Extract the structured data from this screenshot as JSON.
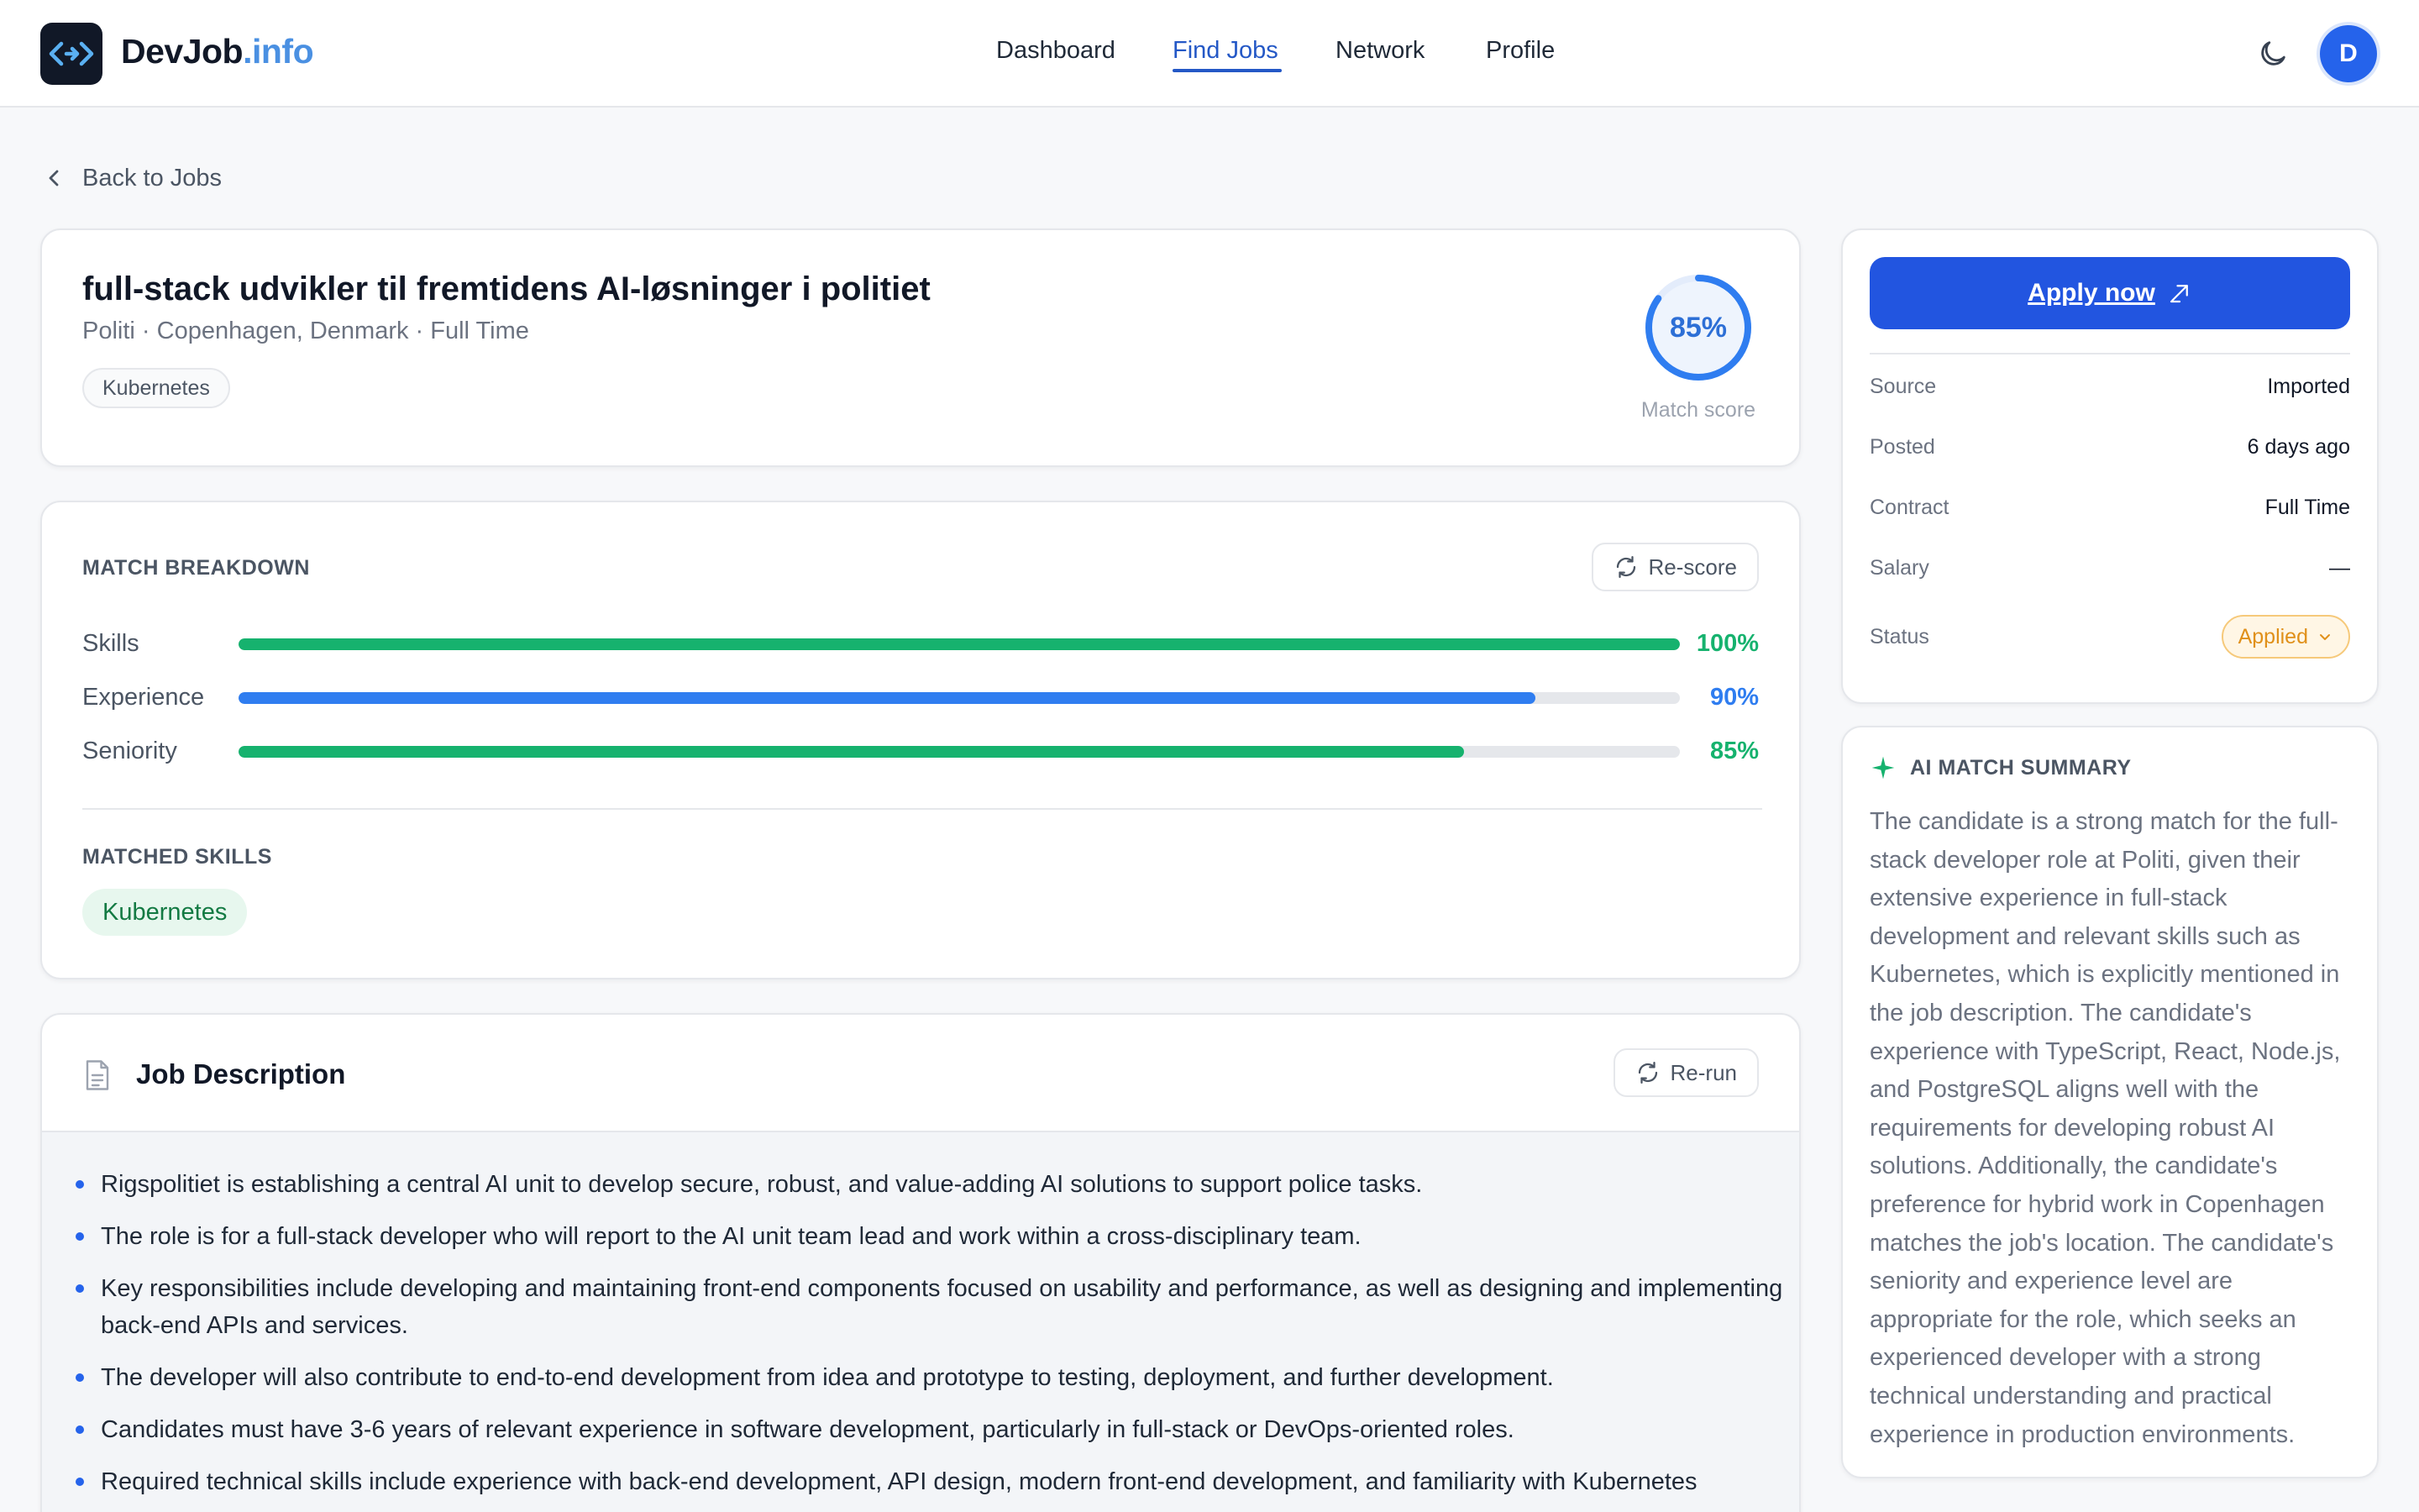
{
  "header": {
    "logo_main": "DevJob",
    "logo_accent": ".info",
    "nav": [
      {
        "label": "Dashboard"
      },
      {
        "label": "Find Jobs"
      },
      {
        "label": "Network"
      },
      {
        "label": "Profile"
      }
    ],
    "avatar_initial": "D"
  },
  "back_link": "Back to Jobs",
  "job": {
    "title": "full-stack udvikler til fremtidens AI-løsninger i politiet",
    "subtitle": "Politi · Copenhagen, Denmark · Full Time",
    "tag": "Kubernetes",
    "match_score": 85,
    "match_score_text": "85%",
    "match_score_label": "Match score"
  },
  "breakdown": {
    "title": "MATCH BREAKDOWN",
    "rescore_label": "Re-score",
    "bars": [
      {
        "label": "Skills",
        "value": 100,
        "pct": "100%",
        "color": "#16b26e"
      },
      {
        "label": "Experience",
        "value": 90,
        "pct": "90%",
        "color": "#2f7df0"
      },
      {
        "label": "Seniority",
        "value": 85,
        "pct": "85%",
        "color": "#16b26e"
      }
    ],
    "matched_title": "MATCHED SKILLS",
    "matched_skills": [
      "Kubernetes"
    ]
  },
  "description": {
    "title": "Job Description",
    "rerun_label": "Re-run",
    "items": [
      "Rigspolitiet is establishing a central AI unit to develop secure, robust, and value-adding AI solutions to support police tasks.",
      "The role is for a full-stack developer who will report to the AI unit team lead and work within a cross-disciplinary team.",
      "Key responsibilities include developing and maintaining front-end components focused on usability and performance, as well as designing and implementing back-end APIs and services.",
      "The developer will also contribute to end-to-end development from idea and prototype to testing, deployment, and further development.",
      "Candidates must have 3-6 years of relevant experience in software development, particularly in full-stack or DevOps-oriented roles.",
      "Required technical skills include experience with back-end development, API design, modern front-end development, and familiarity with Kubernetes"
    ]
  },
  "sidebar": {
    "apply_label": "Apply now",
    "meta": [
      {
        "key": "Source",
        "value": "Imported"
      },
      {
        "key": "Posted",
        "value": "6 days ago"
      },
      {
        "key": "Contract",
        "value": "Full Time"
      },
      {
        "key": "Salary",
        "value": "—"
      }
    ],
    "status_key": "Status",
    "status_value": "Applied",
    "summary_title": "AI MATCH SUMMARY",
    "summary_text": "The candidate is a strong match for the full-stack developer role at Politi, given their extensive experience in full-stack development and relevant skills such as Kubernetes, which is explicitly mentioned in the job description. The candidate's experience with TypeScript, React, Node.js, and PostgreSQL aligns well with the requirements for developing robust AI solutions. Additionally, the candidate's preference for hybrid work in Copenhagen matches the job's location. The candidate's seniority and experience level are appropriate for the role, which seeks an experienced developer with a strong technical understanding and practical experience in production environments."
  },
  "colors": {
    "primary": "#2255e0",
    "accent_blue": "#2f7df0",
    "green": "#16b26e",
    "status_orange": "#e0901a"
  },
  "icons": {
    "logo": "code-arrows-icon",
    "theme": "moon-icon",
    "back": "chevron-left-icon",
    "rescore": "refresh-icon",
    "description": "document-icon",
    "apply": "external-link-icon",
    "status": "chevron-down-icon",
    "summary": "sparkle-icon"
  }
}
